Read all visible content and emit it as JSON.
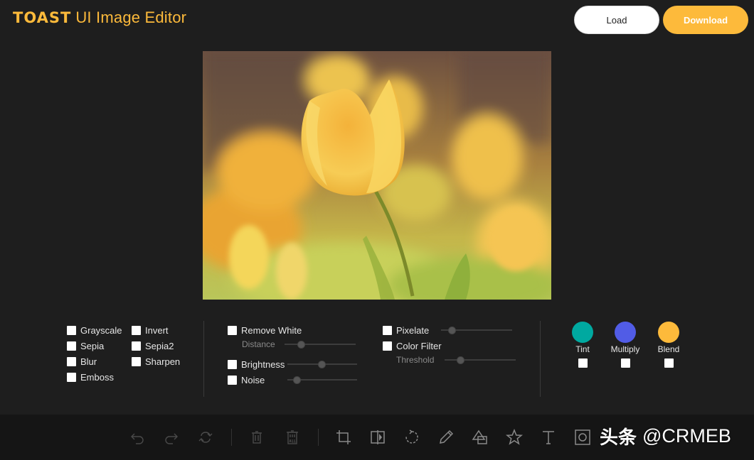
{
  "header": {
    "logo_brand": "TOAST",
    "logo_name": "UI Image Editor",
    "load_label": "Load",
    "download_label": "Download"
  },
  "colors": {
    "accent": "#fdba3b",
    "tint": "#00a9a0",
    "multiply": "#515ce6",
    "blend": "#fdba3b"
  },
  "filters": {
    "basic_col1": [
      "Grayscale",
      "Sepia",
      "Blur",
      "Emboss"
    ],
    "basic_col2": [
      "Invert",
      "Sepia2",
      "Sharpen"
    ],
    "remove_white": "Remove White",
    "distance": "Distance",
    "brightness": "Brightness",
    "noise": "Noise",
    "pixelate": "Pixelate",
    "color_filter": "Color Filter",
    "threshold": "Threshold",
    "tint": "Tint",
    "multiply": "Multiply",
    "blend": "Blend"
  },
  "toolbar": {
    "icons": [
      "undo-icon",
      "redo-icon",
      "reset-icon",
      "delete-icon",
      "delete-all-icon",
      "crop-icon",
      "flip-icon",
      "rotate-icon",
      "draw-icon",
      "shape-icon",
      "icon-star",
      "text-icon",
      "mask-icon"
    ]
  },
  "watermark": {
    "cn": "头条",
    "handle": "@CRMEB"
  }
}
